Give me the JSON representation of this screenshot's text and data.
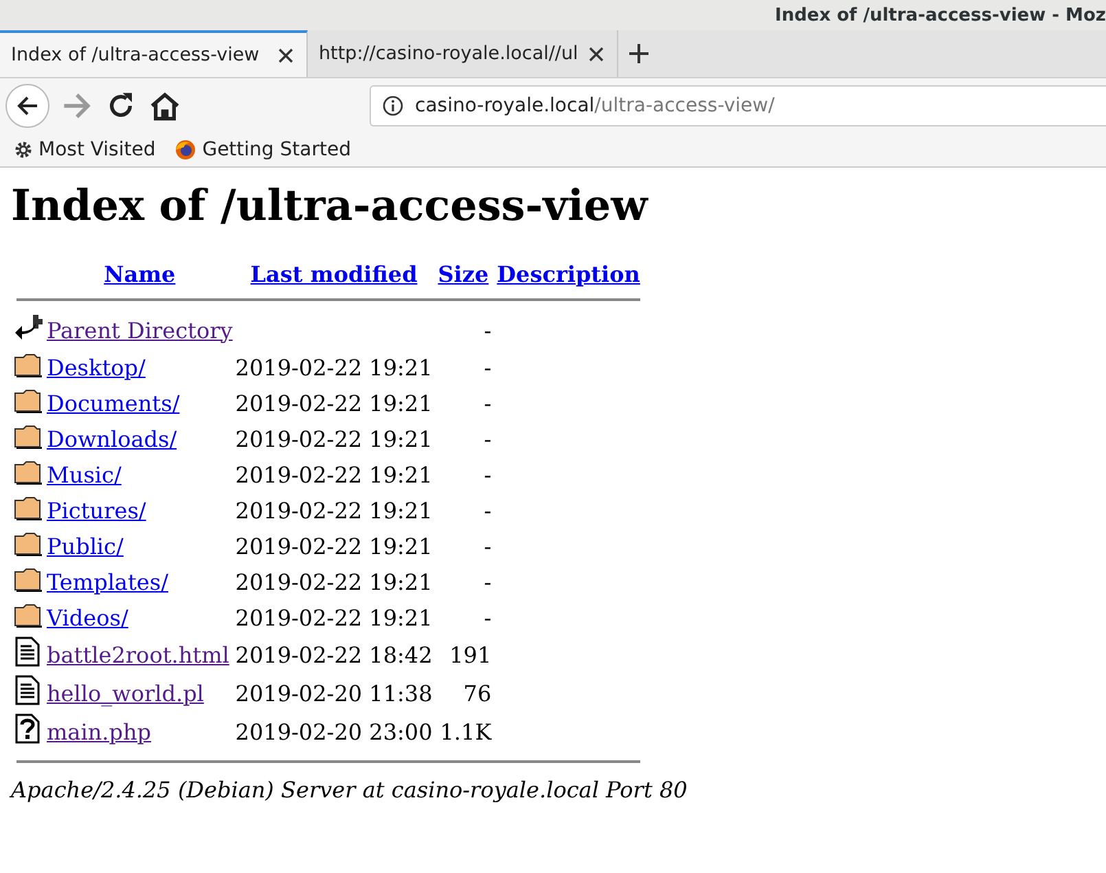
{
  "window": {
    "title": "Index of /ultra-access-view - Moz"
  },
  "tabs": [
    {
      "label": "Index of /ultra-access-view",
      "selected": true
    },
    {
      "label": "http://casino-royale.local//ul",
      "selected": false
    }
  ],
  "address_bar": {
    "host": "casino-royale.local",
    "path": "/ultra-access-view/"
  },
  "bookmarks": [
    {
      "kind": "gear",
      "label": "Most Visited"
    },
    {
      "kind": "firefox",
      "label": "Getting Started"
    }
  ],
  "page": {
    "heading": "Index of /ultra-access-view",
    "columns": [
      "Name",
      "Last modified",
      "Size",
      "Description"
    ],
    "rows": [
      {
        "kind": "back",
        "name": "Parent Directory",
        "modified": "",
        "size": "-",
        "visited": true
      },
      {
        "kind": "folder",
        "name": "Desktop/",
        "modified": "2019-02-22 19:21",
        "size": "-",
        "visited": false
      },
      {
        "kind": "folder",
        "name": "Documents/",
        "modified": "2019-02-22 19:21",
        "size": "-",
        "visited": false
      },
      {
        "kind": "folder",
        "name": "Downloads/",
        "modified": "2019-02-22 19:21",
        "size": "-",
        "visited": false
      },
      {
        "kind": "folder",
        "name": "Music/",
        "modified": "2019-02-22 19:21",
        "size": "-",
        "visited": false
      },
      {
        "kind": "folder",
        "name": "Pictures/",
        "modified": "2019-02-22 19:21",
        "size": "-",
        "visited": false
      },
      {
        "kind": "folder",
        "name": "Public/",
        "modified": "2019-02-22 19:21",
        "size": "-",
        "visited": false
      },
      {
        "kind": "folder",
        "name": "Templates/",
        "modified": "2019-02-22 19:21",
        "size": "-",
        "visited": false
      },
      {
        "kind": "folder",
        "name": "Videos/",
        "modified": "2019-02-22 19:21",
        "size": "-",
        "visited": false
      },
      {
        "kind": "text",
        "name": "battle2root.html",
        "modified": "2019-02-22 18:42",
        "size": "191",
        "visited": true
      },
      {
        "kind": "text",
        "name": "hello_world.pl",
        "modified": "2019-02-20 11:38",
        "size": "76",
        "visited": true
      },
      {
        "kind": "unknown",
        "name": "main.php",
        "modified": "2019-02-20 23:00",
        "size": "1.1K",
        "visited": true
      }
    ],
    "footer": "Apache/2.4.25 (Debian) Server at casino-royale.local Port 80"
  }
}
